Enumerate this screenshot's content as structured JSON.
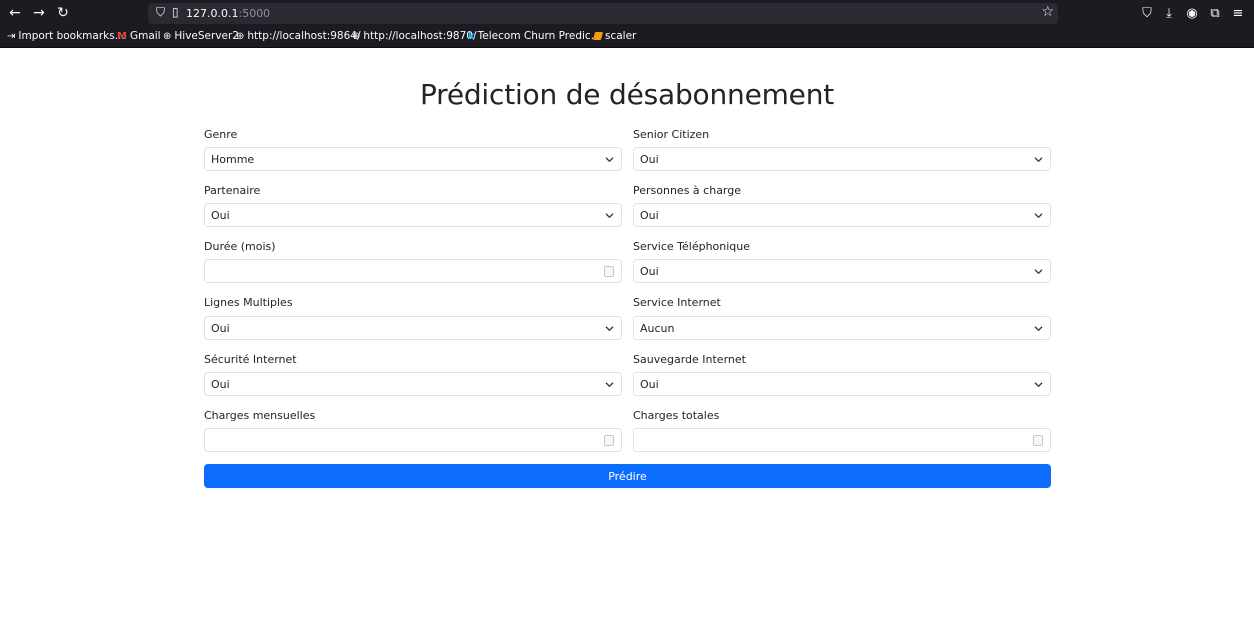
{
  "browser": {
    "url_host": "127.0.0.1",
    "url_port": ":5000",
    "bookmarks": [
      {
        "label": "Import bookmarks...",
        "icon": "import-icon"
      },
      {
        "label": "Gmail",
        "icon": "gmail-icon"
      },
      {
        "label": "HiveServer2",
        "icon": "globe-icon"
      },
      {
        "label": "http://localhost:9864/",
        "icon": "globe-icon"
      },
      {
        "label": "http://localhost:9870/",
        "icon": "globe-icon"
      },
      {
        "label": "Telecom Churn Predic...",
        "icon": "kaggle-icon"
      },
      {
        "label": "scaler",
        "icon": "scaler-icon"
      }
    ]
  },
  "page": {
    "title": "Prédiction de désabonnement",
    "submit_label": "Prédire"
  },
  "form": {
    "gender": {
      "label": "Genre",
      "value": "Homme"
    },
    "senior_citizen": {
      "label": "Senior Citizen",
      "value": "Oui"
    },
    "partner": {
      "label": "Partenaire",
      "value": "Oui"
    },
    "dependents": {
      "label": "Personnes à charge",
      "value": "Oui"
    },
    "tenure": {
      "label": "Durée (mois)",
      "value": ""
    },
    "phone_service": {
      "label": "Service Téléphonique",
      "value": "Oui"
    },
    "multiple_lines": {
      "label": "Lignes Multiples",
      "value": "Oui"
    },
    "internet_service": {
      "label": "Service Internet",
      "value": "Aucun"
    },
    "online_security": {
      "label": "Sécurité Internet",
      "value": "Oui"
    },
    "online_backup": {
      "label": "Sauvegarde Internet",
      "value": "Oui"
    },
    "monthly_charges": {
      "label": "Charges mensuelles",
      "value": ""
    },
    "total_charges": {
      "label": "Charges totales",
      "value": ""
    }
  },
  "colors": {
    "primary": "#0d6efd",
    "toolbar": "#1c1b22",
    "urlbar": "#2b2a33"
  }
}
